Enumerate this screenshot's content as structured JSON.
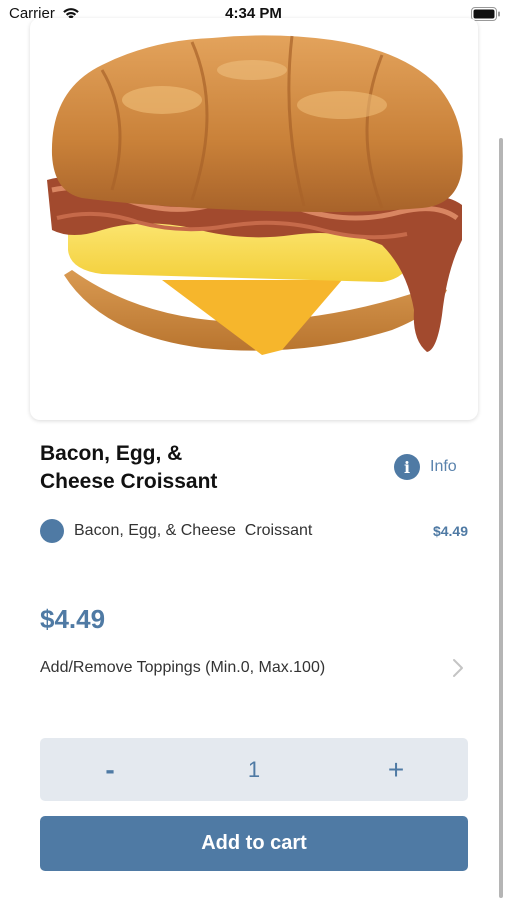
{
  "status_bar": {
    "carrier": "Carrier",
    "time": "4:34 PM",
    "icons": [
      "wifi-icon",
      "battery-icon"
    ]
  },
  "product": {
    "image_icon": "croissant-sandwich-image",
    "title": "Bacon, Egg, &\nCheese  Croissant",
    "info_label": "Info",
    "info_icon": "info-icon"
  },
  "option": {
    "label": "Bacon, Egg, & Cheese  Croissant",
    "price": "$4.49",
    "selected": true
  },
  "total_price": "$4.49",
  "toppings": {
    "label": "Add/Remove Toppings (Min.0, Max.100)",
    "icon": "chevron-right-icon"
  },
  "quantity": {
    "minus_label": "-",
    "value": "1",
    "plus_label": "+"
  },
  "cart": {
    "button_label": "Add to cart"
  },
  "colors": {
    "accent": "#4f7aa4",
    "stepper_bg": "#e4e9ef",
    "text": "#111111"
  }
}
